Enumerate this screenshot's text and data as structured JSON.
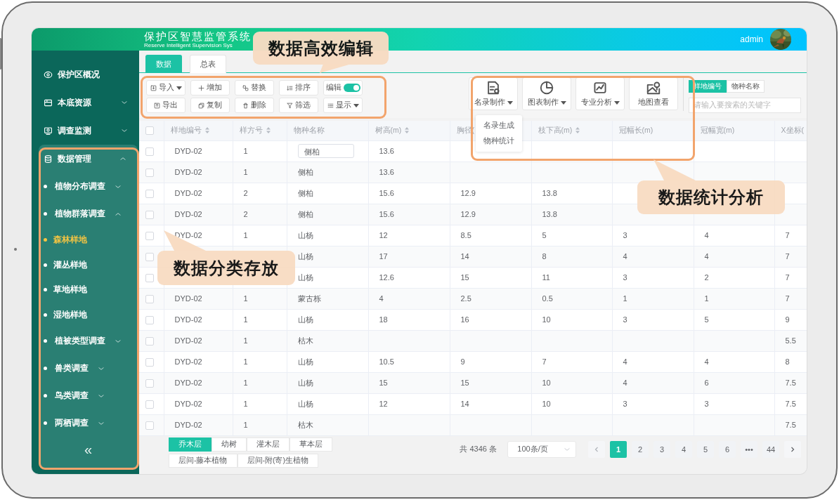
{
  "header": {
    "title": "保护区智慧监管系统",
    "subtitle": "Reserve Intelligent Supervision Sys",
    "user": "admin"
  },
  "sidebar": {
    "items": [
      {
        "label": "保护区概况"
      },
      {
        "label": "本底资源",
        "expanded": false
      },
      {
        "label": "调查监测",
        "expanded": false
      },
      {
        "label": "数据管理",
        "expanded": true,
        "children": [
          {
            "label": "植物分布调查",
            "expanded": false
          },
          {
            "label": "植物群落调查",
            "expanded": true,
            "children": [
              {
                "label": "森林样地",
                "selected": true
              },
              {
                "label": "灌丛样地",
                "selected": false
              },
              {
                "label": "草地样地",
                "selected": false
              },
              {
                "label": "湿地样地",
                "selected": false
              }
            ]
          },
          {
            "label": "植被类型调查",
            "expanded": false
          },
          {
            "label": "兽类调查",
            "expanded": false
          },
          {
            "label": "鸟类调查",
            "expanded": false
          },
          {
            "label": "两栖调查",
            "expanded": false
          }
        ]
      }
    ],
    "collapse": "«"
  },
  "tabs": [
    {
      "label": "数据",
      "selected": true
    },
    {
      "label": "总表",
      "selected": false
    }
  ],
  "toolbar": {
    "buttons": [
      {
        "label": "导入",
        "kind": "button",
        "dropdown": true
      },
      {
        "label": "增加",
        "kind": "button",
        "dropdown": false
      },
      {
        "label": "替换",
        "kind": "button",
        "dropdown": false
      },
      {
        "label": "排序",
        "kind": "button",
        "dropdown": false
      },
      {
        "label": "编辑",
        "kind": "toggle",
        "on": true
      },
      {
        "label": "导出",
        "kind": "button",
        "dropdown": false
      },
      {
        "label": "复制",
        "kind": "button",
        "dropdown": false
      },
      {
        "label": "删除",
        "kind": "button",
        "dropdown": false
      },
      {
        "label": "筛选",
        "kind": "button",
        "dropdown": false
      },
      {
        "label": "显示",
        "kind": "button",
        "dropdown": true
      }
    ]
  },
  "analysis": {
    "buttons": [
      {
        "label": "名录制作",
        "dropdown": true
      },
      {
        "label": "图表制作",
        "dropdown": true
      },
      {
        "label": "专业分析",
        "dropdown": true
      },
      {
        "label": "地图查看",
        "dropdown": false
      }
    ],
    "menu": [
      "名录生成",
      "物种统计"
    ]
  },
  "search": {
    "modes": [
      {
        "label": "样地编号",
        "selected": true
      },
      {
        "label": "物种名称",
        "selected": false
      }
    ],
    "placeholder": "请输入要搜索的关键字"
  },
  "table": {
    "select_all": false,
    "columns": [
      {
        "label": "样地编号",
        "sortable": true
      },
      {
        "label": "样方号",
        "sortable": true
      },
      {
        "label": "物种名称",
        "sortable": false
      },
      {
        "label": "树高(m)",
        "sortable": true
      },
      {
        "label": "胸径(",
        "sortable": false
      },
      {
        "label": "枝下高(m)",
        "sortable": true
      },
      {
        "label": "冠幅长(m)",
        "sortable": false
      },
      {
        "label": "冠幅宽(m)",
        "sortable": false
      },
      {
        "label": "X坐标(",
        "sortable": false
      }
    ],
    "rows": [
      {
        "checked": false,
        "cells": [
          "DYD-02",
          "1",
          {
            "value": "侧柏",
            "kind": "input"
          },
          "13.6",
          null,
          null,
          null,
          null,
          null
        ]
      },
      {
        "checked": false,
        "cells": [
          "DYD-02",
          "1",
          "侧柏",
          "13.6",
          null,
          null,
          null,
          null,
          null
        ]
      },
      {
        "checked": false,
        "cells": [
          "DYD-02",
          "2",
          "侧柏",
          "15.6",
          "12.9",
          "13.8",
          null,
          null,
          null
        ]
      },
      {
        "checked": false,
        "cells": [
          "DYD-02",
          "2",
          "侧柏",
          "15.6",
          "12.9",
          "13.8",
          null,
          null,
          null
        ]
      },
      {
        "checked": false,
        "cells": [
          "DYD-02",
          "1",
          "山杨",
          "12",
          "8.5",
          "5",
          "3",
          "4",
          "7"
        ]
      },
      {
        "checked": false,
        "cells": [
          null,
          null,
          "山杨",
          "17",
          "14",
          "8",
          "4",
          "4",
          "7"
        ]
      },
      {
        "checked": false,
        "cells": [
          null,
          null,
          "山杨",
          "12.6",
          "15",
          "11",
          "3",
          "2",
          "7"
        ]
      },
      {
        "checked": false,
        "cells": [
          "DYD-02",
          "1",
          "蒙古栎",
          "4",
          "2.5",
          "0.5",
          "1",
          "1",
          "7"
        ]
      },
      {
        "checked": false,
        "cells": [
          "DYD-02",
          "1",
          "山杨",
          "18",
          "16",
          "10",
          "3",
          "5",
          "9"
        ]
      },
      {
        "checked": false,
        "cells": [
          "DYD-02",
          "1",
          "枯木",
          null,
          null,
          null,
          null,
          null,
          "5.5"
        ]
      },
      {
        "checked": false,
        "cells": [
          "DYD-02",
          "1",
          "山杨",
          "10.5",
          "9",
          "7",
          "4",
          "4",
          "8"
        ]
      },
      {
        "checked": false,
        "cells": [
          "DYD-02",
          "1",
          "山杨",
          "15",
          "15",
          "10",
          "4",
          "6",
          "7.5"
        ]
      },
      {
        "checked": false,
        "cells": [
          "DYD-02",
          "1",
          "山杨",
          "12",
          "14",
          "10",
          "3",
          "3",
          "7.5"
        ]
      },
      {
        "checked": false,
        "cells": [
          "DYD-02",
          "1",
          "枯木",
          null,
          null,
          null,
          null,
          null,
          "7.5"
        ]
      }
    ]
  },
  "layer_tabs": [
    {
      "label": "乔木层",
      "selected": true
    },
    {
      "label": "幼树",
      "selected": false
    },
    {
      "label": "灌木层",
      "selected": false
    },
    {
      "label": "草本层",
      "selected": false
    },
    {
      "label": "层间-藤本植物",
      "selected": false
    },
    {
      "label": "层间-附(寄)生植物",
      "selected": false
    }
  ],
  "pagination": {
    "total": "共 4346 条",
    "page_size": "100条/页",
    "pages": [
      {
        "label": "1",
        "selected": true
      },
      {
        "label": "2",
        "selected": false
      },
      {
        "label": "3",
        "selected": false
      },
      {
        "label": "4",
        "selected": false
      },
      {
        "label": "5",
        "selected": false
      },
      {
        "label": "6",
        "selected": false
      },
      {
        "label": "•••",
        "selected": false
      },
      {
        "label": "44",
        "selected": false
      }
    ]
  },
  "callouts": [
    {
      "text": "数据高效编辑"
    },
    {
      "text": "数据统计分析"
    },
    {
      "text": "数据分类存放"
    }
  ]
}
